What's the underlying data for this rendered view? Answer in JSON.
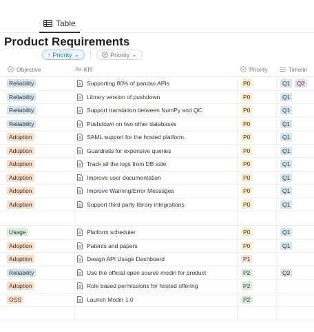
{
  "view": {
    "tab_label": "Table"
  },
  "title": "Product Requirements",
  "filters": {
    "active_label": "Priority",
    "secondary_label": "Priority"
  },
  "columns": {
    "objective": "Objective",
    "kr_prefix": "Aa",
    "kr": "KR",
    "priority": "Priority",
    "timeline": "Timelin"
  },
  "colors": {
    "Reliability": "#d3e5ef",
    "Adoption": "#fadec9",
    "Usage": "#dbeddb",
    "OSS": "#fadec9",
    "P0": "#fdecc8",
    "P1": "#ffe2dd",
    "P2": "#dbeddb",
    "Q1": "#d3e5ef",
    "Q2": "#e8deee"
  },
  "rows": [
    {
      "objective": "Reliability",
      "kr": "Supporting 80% of pandas APIs",
      "priority": "P0",
      "timeline": [
        "Q1",
        "Q2"
      ]
    },
    {
      "objective": "Reliability",
      "kr": "Library version of pushdown",
      "priority": "P0",
      "timeline": [
        "Q1"
      ]
    },
    {
      "objective": "Reliability",
      "kr": "Support translation between NumPy and QC",
      "priority": "P0",
      "timeline": [
        "Q1"
      ]
    },
    {
      "objective": "Reliability",
      "kr": "Pushdown on two other databases",
      "priority": "P0",
      "timeline": [
        "Q1"
      ]
    },
    {
      "objective": "Adoption",
      "kr": "SAML support for the hosted platform.",
      "priority": "P0",
      "timeline": [
        "Q1"
      ]
    },
    {
      "objective": "Adoption",
      "kr": "Guardrails for expensive queries",
      "priority": "P0",
      "timeline": [
        "Q1"
      ]
    },
    {
      "objective": "Adoption",
      "kr": "Track all the logs from DB side",
      "priority": "P0",
      "timeline": [
        "Q1"
      ]
    },
    {
      "objective": "Adoption",
      "kr": "Improve user documentation",
      "priority": "P0",
      "timeline": [
        "Q1"
      ]
    },
    {
      "objective": "Adoption",
      "kr": "Improve Warning/Error Messages",
      "priority": "P0",
      "timeline": [
        "Q1"
      ]
    },
    {
      "objective": "Adoption",
      "kr": "Support third party library integrations",
      "priority": "P0",
      "timeline": [
        "Q1"
      ]
    },
    {
      "gap": true
    },
    {
      "objective": "Usage",
      "kr": "Platform scheduler",
      "priority": "P0",
      "timeline": [
        "Q1"
      ]
    },
    {
      "objective": "Adoption",
      "kr": "Patents and papers",
      "priority": "P0",
      "timeline": [
        "Q1"
      ]
    },
    {
      "objective": "Adoption",
      "kr": "Design API Usage Dashboard",
      "priority": "P1",
      "timeline": []
    },
    {
      "objective": "Reliability",
      "kr": "Use the official open source modin for product",
      "priority": "P2",
      "timeline": [
        "Q2"
      ]
    },
    {
      "objective": "Adoption",
      "kr": "Role based permissions for hosted offering",
      "priority": "P2",
      "timeline": []
    },
    {
      "objective": "OSS",
      "kr": "Launch Modin 1.0",
      "priority": "P2",
      "timeline": []
    },
    {
      "empty": true
    }
  ]
}
